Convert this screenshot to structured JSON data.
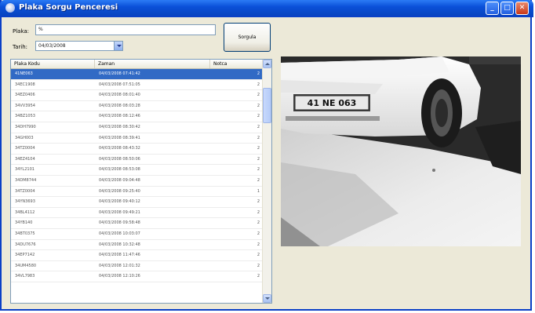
{
  "window": {
    "title": "Plaka Sorgu Penceresi"
  },
  "form": {
    "plate_label": "Plaka:",
    "plate_value": "%",
    "date_label": "Tarih:",
    "date_value": "04/03/2008",
    "query_button": "Sorgula"
  },
  "grid": {
    "columns": [
      "Plaka Kodu",
      "Zaman",
      "Notca"
    ],
    "rows": [
      {
        "plate": "41NE063",
        "time": "04/03/2008 07:41:42",
        "count": "2"
      },
      {
        "plate": "34EC1908",
        "time": "04/03/2008 07:51:05",
        "count": "2"
      },
      {
        "plate": "34EZ0406",
        "time": "04/03/2008 08:01:40",
        "count": "2"
      },
      {
        "plate": "34VV3954",
        "time": "04/03/2008 08:03:28",
        "count": "2"
      },
      {
        "plate": "34BZ1053",
        "time": "04/03/2008 08:12:46",
        "count": "2"
      },
      {
        "plate": "34DH7990",
        "time": "04/03/2008 08:30:42",
        "count": "2"
      },
      {
        "plate": "34GH003",
        "time": "04/03/2008 08:39:41",
        "count": "2"
      },
      {
        "plate": "34TZ0004",
        "time": "04/03/2008 08:43:32",
        "count": "2"
      },
      {
        "plate": "34EZ4104",
        "time": "04/03/2008 08:50:06",
        "count": "2"
      },
      {
        "plate": "34YL2101",
        "time": "04/03/2008 08:53:08",
        "count": "2"
      },
      {
        "plate": "34DM8744",
        "time": "04/03/2008 09:04:48",
        "count": "2"
      },
      {
        "plate": "34TZ0004",
        "time": "04/03/2008 09:25:40",
        "count": "1"
      },
      {
        "plate": "34YN3693",
        "time": "04/03/2008 09:40:12",
        "count": "2"
      },
      {
        "plate": "34BL4112",
        "time": "04/03/2008 09:49:21",
        "count": "2"
      },
      {
        "plate": "34YB140",
        "time": "04/03/2008 09:58:48",
        "count": "2"
      },
      {
        "plate": "34BT0375",
        "time": "04/03/2008 10:03:07",
        "count": "2"
      },
      {
        "plate": "34DU7676",
        "time": "04/03/2008 10:32:48",
        "count": "2"
      },
      {
        "plate": "34EP7142",
        "time": "04/03/2008 11:47:46",
        "count": "2"
      },
      {
        "plate": "34UM4580",
        "time": "04/03/2008 12:01:32",
        "count": "2"
      },
      {
        "plate": "34VL7983",
        "time": "04/03/2008 12:10:26",
        "count": "2"
      }
    ]
  },
  "photo": {
    "plate_text": "41 NE 063"
  }
}
